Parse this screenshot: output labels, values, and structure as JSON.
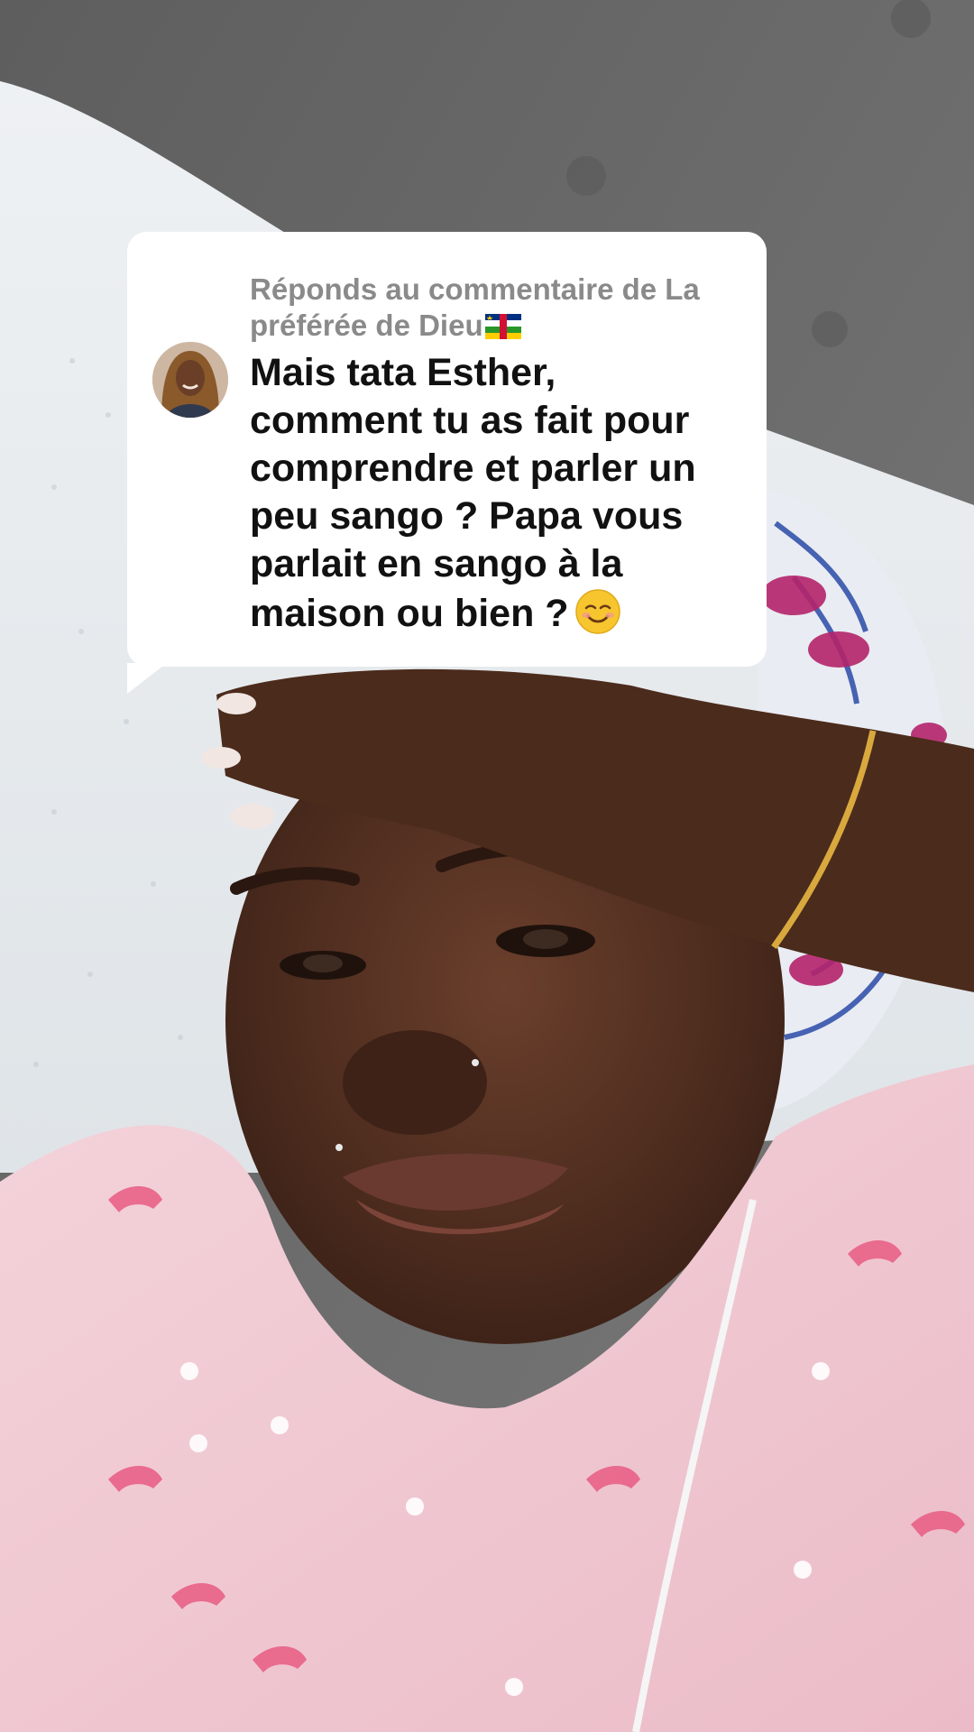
{
  "reply_sticker": {
    "header": "Réponds au commentaire de La préférée de Dieu",
    "header_flag_icon": "central-african-republic-flag-icon",
    "avatar_icon": "commenter-avatar",
    "comment_text": "Mais tata Esther,\ncomment tu as fait pour\ncomprendre et parler un\npeu sango ? Papa vous\nparlait en sango à la\nmaison ou bien ?",
    "comment_emoji": "smiling-face-emoji"
  },
  "colors": {
    "sticker_background": "#ffffff",
    "header_text": "#8a8a8a",
    "comment_text": "#111111",
    "couch_gray": "#6a6a6a",
    "pajama_pink": "#f2c9d2",
    "flamingo_pink": "#e85b83"
  }
}
